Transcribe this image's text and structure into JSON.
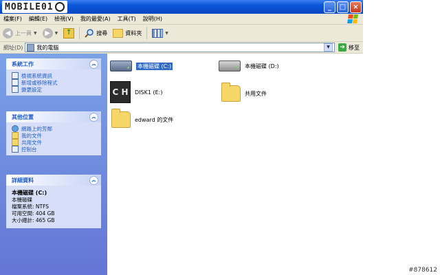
{
  "window": {
    "logo_text": "MOBILE01",
    "controls": {
      "minimize": "_",
      "maximize": "□",
      "close": "×"
    }
  },
  "menu": [
    "檔案(F)",
    "編輯(E)",
    "檢視(V)",
    "我的最愛(A)",
    "工具(T)",
    "說明(H)"
  ],
  "toolbar": {
    "back": "上一頁",
    "search": "搜尋",
    "folders": "資料夾"
  },
  "address": {
    "label": "網址(D)",
    "value": "我的電腦",
    "go": "移至"
  },
  "tasks": {
    "system": {
      "title": "系統工作",
      "items": [
        "檢視系統資訊",
        "新增或移除程式",
        "變更設定"
      ]
    },
    "other": {
      "title": "其他位置",
      "items": [
        "網路上的芳鄰",
        "我的文件",
        "共用文件",
        "控制台"
      ]
    },
    "details": {
      "title": "詳細資料",
      "name": "本機磁碟 (C:)",
      "type": "本機磁碟",
      "fs": "檔案系統: NTFS",
      "free": "可用空間: 404 GB",
      "total": "大小總計: 465 GB"
    }
  },
  "files": [
    {
      "label": "本機磁碟 (C:)",
      "icon": "hard-drive-icon"
    },
    {
      "label": "本機磁碟 (D:)",
      "icon": "hard-drive-icon"
    },
    {
      "label": "DISK1 (E:)",
      "icon": "disk-icon",
      "badge": "C H"
    },
    {
      "label": "共用文件",
      "icon": "folder-icon"
    },
    {
      "label": "edward 的文件",
      "icon": "folder-icon"
    }
  ],
  "watermark": "#878612",
  "colors": {
    "title_bar": "#0a55d8",
    "task_pane": "#6375d6",
    "link": "#215dc6",
    "selection": "#316ac5"
  }
}
